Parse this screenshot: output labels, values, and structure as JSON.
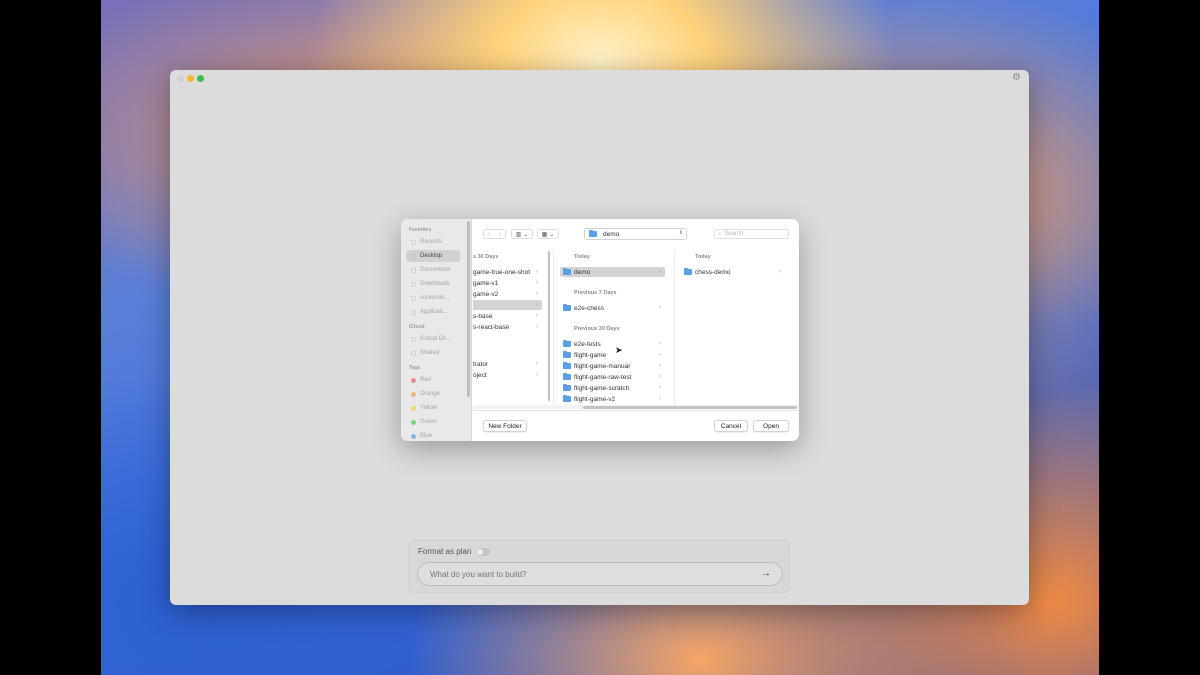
{
  "dialog": {
    "sidebar": {
      "sections": [
        {
          "heading": "Favorites",
          "items": [
            {
              "label": "Recents",
              "icon": "clock-icon",
              "selected": false
            },
            {
              "label": "Desktop",
              "icon": "desktop-icon",
              "selected": true
            },
            {
              "label": "Documents",
              "icon": "document-icon",
              "selected": false
            },
            {
              "label": "Downloads",
              "icon": "download-icon",
              "selected": false
            },
            {
              "label": "screensh...",
              "icon": "folder-icon",
              "selected": false
            },
            {
              "label": "Applicati...",
              "icon": "applications-icon",
              "selected": false
            }
          ]
        },
        {
          "heading": "iCloud",
          "items": [
            {
              "label": "iCloud Dri...",
              "icon": "cloud-icon",
              "selected": false
            },
            {
              "label": "Shared",
              "icon": "shared-folder-icon",
              "selected": false
            }
          ]
        },
        {
          "heading": "Tags",
          "items": [
            {
              "label": "Red",
              "color": "#f08a8a"
            },
            {
              "label": "Orange",
              "color": "#f5b77a"
            },
            {
              "label": "Yellow",
              "color": "#f3d36a"
            },
            {
              "label": "Green",
              "color": "#7fd07f"
            },
            {
              "label": "Blue",
              "color": "#8ab4f0"
            }
          ]
        }
      ]
    },
    "toolbar": {
      "location": "demo",
      "search_placeholder": "Search"
    },
    "columns": [
      {
        "groups": [
          {
            "heading": "s 30 Days",
            "rows": [
              {
                "name": "game-true-one-shot",
                "folder": false,
                "selected": false
              },
              {
                "name": "game-v1",
                "folder": false,
                "selected": false
              },
              {
                "name": "game-v2",
                "folder": false,
                "selected": false
              },
              {
                "name": "",
                "folder": false,
                "selected": true
              },
              {
                "name": "s-base",
                "folder": false,
                "selected": false
              },
              {
                "name": "s-react-base",
                "folder": false,
                "selected": false
              },
              {
                "name": "trator",
                "folder": false,
                "selected": false
              },
              {
                "name": "oject",
                "folder": false,
                "selected": false
              }
            ]
          }
        ]
      },
      {
        "groups": [
          {
            "heading": "Today",
            "rows": [
              {
                "name": "demo",
                "folder": true,
                "selected": true
              }
            ]
          },
          {
            "heading": "Previous 7 Days",
            "rows": [
              {
                "name": "e2e-chess",
                "folder": true,
                "selected": false
              }
            ]
          },
          {
            "heading": "Previous 30 Days",
            "rows": [
              {
                "name": "e2e-tests",
                "folder": true,
                "selected": false
              },
              {
                "name": "flight-game",
                "folder": true,
                "selected": false
              },
              {
                "name": "flight-game-manual",
                "folder": true,
                "selected": false
              },
              {
                "name": "flight-game-raw-test",
                "folder": true,
                "selected": false
              },
              {
                "name": "flight-game-scratch",
                "folder": true,
                "selected": false
              },
              {
                "name": "flight-game-v2",
                "folder": true,
                "selected": false
              }
            ]
          }
        ]
      },
      {
        "groups": [
          {
            "heading": "Today",
            "rows": [
              {
                "name": "chess-demo",
                "folder": true,
                "selected": false
              }
            ]
          }
        ]
      }
    ],
    "buttons": {
      "new_folder": "New Folder",
      "cancel": "Cancel",
      "open": "Open"
    }
  },
  "prompt": {
    "format_label": "Format as plan",
    "placeholder": "What do you want to build?"
  }
}
